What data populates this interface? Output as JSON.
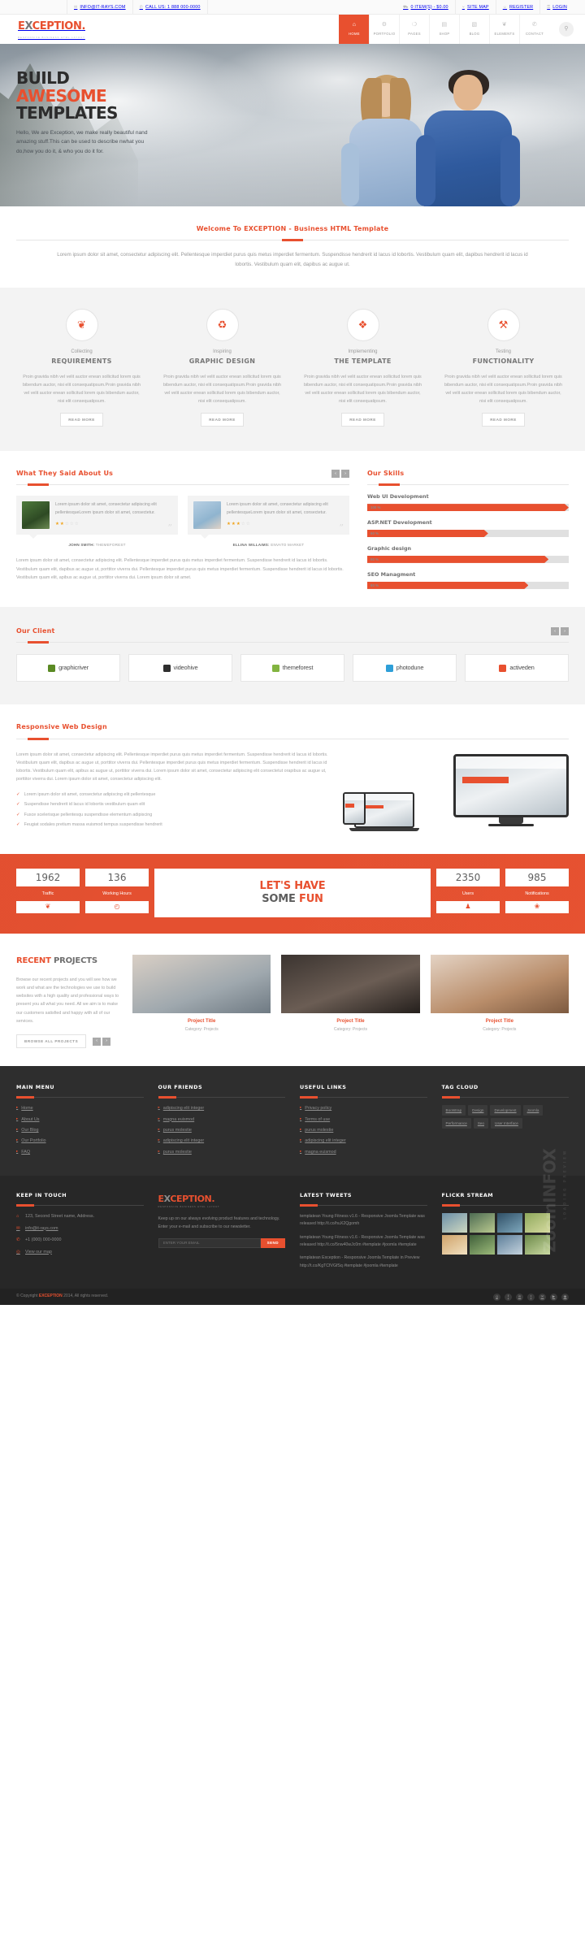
{
  "topbar": {
    "left": [
      {
        "icon": "envelope-icon",
        "glyph": "✉",
        "label": "INFO@IT-RAYS.COM"
      },
      {
        "icon": "phone-icon",
        "glyph": "✆",
        "label": "CALL US: 1 888 000-0000"
      }
    ],
    "right": [
      {
        "icon": "cart-icon",
        "glyph": "⛟",
        "label": "0 ITEM(S) - $0.00"
      },
      {
        "icon": "sitemap-icon",
        "glyph": "⑂",
        "label": "SITE MAP"
      },
      {
        "icon": "user-icon",
        "glyph": "☺",
        "label": "REGISTER"
      },
      {
        "icon": "lock-icon",
        "glyph": "⚿",
        "label": "LOGIN"
      }
    ]
  },
  "header": {
    "logo": {
      "pre": "E",
      "x": "X",
      "post": "CEPTION",
      "dot": ".",
      "subtitle": "RESPONSIVE BUSINESS HTML LAYOUT"
    },
    "nav": [
      {
        "label": "HOME",
        "glyph": "⌂",
        "active": true,
        "name": "nav-home"
      },
      {
        "label": "PORTFOLIO",
        "glyph": "⚙",
        "active": false,
        "name": "nav-portfolio"
      },
      {
        "label": "PAGES",
        "glyph": "❍",
        "active": false,
        "name": "nav-pages"
      },
      {
        "label": "SHOP",
        "glyph": "▤",
        "active": false,
        "name": "nav-shop"
      },
      {
        "label": "BLOG",
        "glyph": "▧",
        "active": false,
        "name": "nav-blog"
      },
      {
        "label": "ELEMENTS",
        "glyph": "❦",
        "active": false,
        "name": "nav-elements"
      },
      {
        "label": "CONTACT",
        "glyph": "✆",
        "active": false,
        "name": "nav-contact"
      }
    ],
    "search_glyph": "⚲"
  },
  "hero": {
    "line1": "BUILD",
    "line2": "AWESOME",
    "line3": "TEMPLATES",
    "paragraph": "Hello, We are Exception, we make really beautiful nand amazing stuff.This can be used to describe nwhat you do,how you do it, & who you do it for."
  },
  "welcome": {
    "title": "Welcome To EXCEPTION - Business HTML Template",
    "text": "Lorem ipsum dolor sit amet, consectetur adipiscing elit. Pellentesque imperdiet purus quis metus imperdiet fermentum. Suspendisse hendrerit id lacus id lobortis. Vestibulum quam elit, dapibus hendrerit id lacus id lobortis. Vestibulum quam elit, dapibus ac augue ut."
  },
  "services": [
    {
      "icon": "leaf-icon",
      "glyph": "❦",
      "pre": "Collecting",
      "title": "REQUIREMENTS",
      "text": "Proin gravida nibh vel velit auctor enean sollicitud lorem quis bibendum auctor, nisi elit consequatipsum.Proin gravida nibh vel velit auctor enean sollicitud lorem quis bibendum auctor, nisi elit consequatipsum.",
      "button": "READ MORE"
    },
    {
      "icon": "recycle-icon",
      "glyph": "♻",
      "pre": "Inspiring",
      "title": "GRAPHIC DESIGN",
      "text": "Proin gravida nibh vel velit auctor enean sollicitud lorem quis bibendum auctor, nisi elit consequatipsum.Proin gravida nibh vel velit auctor enean sollicitud lorem quis bibendum auctor, nisi elit consequatipsum.",
      "button": "READ MORE"
    },
    {
      "icon": "puzzle-icon",
      "glyph": "❖",
      "pre": "Implementing",
      "title": "THE TEMPLATE",
      "text": "Proin gravida nibh vel velit auctor enean sollicitud lorem quis bibendum auctor, nisi elit consequatipsum.Proin gravida nibh vel velit auctor enean sollicitud lorem quis bibendum auctor, nisi elit consequatipsum.",
      "button": "READ MORE"
    },
    {
      "icon": "wrench-icon",
      "glyph": "⚒",
      "pre": "Testing",
      "title": "FUNCTIONALITY",
      "text": "Proin gravida nibh vel velit auctor enean sollicitud lorem quis bibendum auctor, nisi elit consequatipsum.Proin gravida nibh vel velit auctor enean sollicitud lorem quis bibendum auctor, nisi elit consequatipsum.",
      "button": "READ MORE"
    }
  ],
  "testimonials": {
    "title": "What They Said About Us",
    "prev": "‹",
    "next": "›",
    "items": [
      {
        "text": "Lorem ipsum dolor sit amet, consectetur adipiscing elit pellentesqueLorem ipsum dolor sit amet, consectetur.",
        "stars": 2,
        "name": "JOHN SMITH:",
        "company": " THEMEFOREST"
      },
      {
        "text": "Lorem ipsum dolor sit amet, consectetur adipiscing elit pellentesqueLorem ipsum dolor sit amet, consectetur.",
        "stars": 3,
        "name": "ELLINA WILLAIMS:",
        "company": " ENVATO MARKET"
      }
    ],
    "paragraph": "Lorem ipsum dolor sit amet, consectetur adipiscing elit. Pellentesque imperdiet purus quis metus imperdiet fermentum. Suspendisse hendrerit id lacus id lobortis. Vestibulum quam elit, dapibus ac augue ut, porttitor viverra dui. Pellentesque imperdiet purus quis metus imperdiet fermentum. Suspendisse hendrerit id lacus id lobortis. Vestibulum quam elit, apibus ac augue ut, porttitor viverra dui. Lorem ipsum dolor sit amet."
  },
  "skills": {
    "title": "Our Skills",
    "items": [
      {
        "name": "Web UI Development",
        "value": 100,
        "label": "100 %"
      },
      {
        "name": "ASP.NET Development",
        "value": 60,
        "label": "60 %"
      },
      {
        "name": "Graphic design",
        "value": 90,
        "label": "90 %"
      },
      {
        "name": "SEO Managment",
        "value": 80,
        "label": "80 %"
      }
    ]
  },
  "clients": {
    "title": "Our Client",
    "prev": "‹",
    "next": "›",
    "items": [
      {
        "name": "graphicriver",
        "color": "#5a8a23"
      },
      {
        "name": "videohive",
        "color": "#2e2e2e"
      },
      {
        "name": "themeforest",
        "color": "#82b440"
      },
      {
        "name": "photodune",
        "color": "#2e9fd8"
      },
      {
        "name": "activeden",
        "color": "#e8502f"
      }
    ]
  },
  "responsive": {
    "title": "Responsive Web Design",
    "paragraph": "Lorem ipsum dolor sit amet, consectetur adipiscing elit. Pellentesque imperdiet purus quis metus imperdiet fermentum. Suspendisse hendrerit id lacus id lobortis. Vestibulum quam elit, dapibus ac augue ut, porttitor viverra dui. Pellentesque imperdiet purus quis metus imperdiet fermentum. Suspendisse hendrerit id lacus id lobortis. Vestibulum quam elit, apibus ac augue ut, porttitor viverra dui. Lorem ipsum dolor sit amet, consectetur adipiscing elit consectetut orapibus ac augue ut, porttitor viverra dui. Lorem ipsum dolor sit amet, consectetur adipiscing elit.",
    "checks": [
      "Lorem ipsum dolor sit amet, consectetur adipiscing elit pellentesque",
      "Suspendisse hendrerit id lacus id lobortis vestibulum quam elit",
      "Fusce scelerisque pellentesqu suspendisse elementum adipiscing",
      "Feugiat sodales pretium massa euismod tempus suspendisse hendrerit"
    ],
    "check_glyph": "✓"
  },
  "fun": {
    "counters_left": [
      {
        "number": "1962",
        "label": "Traffic",
        "icon": "leaf-icon",
        "glyph": "❦"
      },
      {
        "number": "136",
        "label": "Working Hours",
        "icon": "clock-icon",
        "glyph": "◴"
      }
    ],
    "counters_right": [
      {
        "number": "2350",
        "label": "Users",
        "icon": "users-icon",
        "glyph": "♟"
      },
      {
        "number": "985",
        "label": "Notifications",
        "icon": "bell-icon",
        "glyph": "❀"
      }
    ],
    "card_line1": "LET'S HAVE",
    "card_line2_a": "SOME ",
    "card_line2_b": "FUN"
  },
  "projects": {
    "title_a": "RECENT",
    "title_b": " PROJECTS",
    "paragraph": "Browse our recent projects and you will see how we work and what are the technologies we use to build websites with a high quality and professional ways to present you all what you need. All we aim is to make our customers satisfied and happy with all of our services.",
    "button": "BROWSE ALL PROJECTS",
    "prev": "‹",
    "next": "›",
    "cards": [
      {
        "title": "Project Title",
        "category": "Category: Projects"
      },
      {
        "title": "Project Title",
        "category": "Category: Projects"
      },
      {
        "title": "Project Title",
        "category": "Category: Projects"
      }
    ]
  },
  "footer": {
    "columns": [
      {
        "heading": "MAIN MENU",
        "items": [
          "Home",
          "About Us",
          "Our Blog",
          "Our Portfolio",
          "FAQ"
        ]
      },
      {
        "heading": "OUR FRIENDS",
        "items": [
          "adipiscing elit integer",
          "magna euismod",
          "purus molestie",
          "adipiscing elit integer",
          "purus molestie"
        ]
      },
      {
        "heading": "USEFUL LINKS",
        "items": [
          "Privacy policy",
          "Terms of use",
          "purus molestie",
          "adipiscing elit integer",
          "magna euismod"
        ]
      }
    ],
    "tagcloud": {
      "heading": "TAG CLOUD",
      "tags": [
        "Bootstrap",
        "Design",
        "Development",
        "Joomla",
        "Performance",
        "Seo",
        "User Interface"
      ]
    },
    "keep_in_touch": {
      "heading": "KEEP IN TOUCH",
      "items": [
        {
          "icon": "location-icon",
          "glyph": "⌂",
          "text": "123, Second Street name, Address."
        },
        {
          "icon": "envelope-icon",
          "glyph": "✉",
          "text": "info@it-rays.com"
        },
        {
          "icon": "phone-icon",
          "glyph": "✆",
          "text": "+1 (000) 000-0000"
        },
        {
          "icon": "map-icon",
          "glyph": "◎",
          "text": "View our map"
        }
      ]
    },
    "newsletter": {
      "logo_pre": "E",
      "logo_x": "X",
      "logo_post": "CEPTION",
      "logo_dot": ".",
      "logo_sub": "RESPONSIVE BUSINESS HTML LAYOUT",
      "text": "Keep up on our always evolving product features and technology. Enter your e-mail and subscribe to our newsletter.",
      "placeholder": "ENTER YOUR EMAIL",
      "button": "SEND"
    },
    "tweets": {
      "heading": "LATEST TWEETS",
      "items": [
        "templatean Young Fitness v1.6 - Responsive Joomla Template was released http://t.co/huX2Qgomh",
        "templatean Young Fitness v1.6 - Responsive Joomla Template was released http://t.co/5nw40wJc0m #template #joomla #template",
        "templatean Exception - Responsive Joomla Template in Preview http://t.co/KgTCfVGfSq #template #joomla #template"
      ]
    },
    "flickr": {
      "heading": "FLICKR STREAM"
    },
    "copyright_pre": "© Copyright ",
    "copyright_brand": "EXCEPTION",
    "copyright_post": " 2014, All rights reserved.",
    "social": [
      "g",
      "f",
      "in",
      "t",
      "✉",
      "▶",
      "◉"
    ]
  },
  "watermark": {
    "text": "ZoomINFOX",
    "sub": "LOADING PREVIEW"
  }
}
